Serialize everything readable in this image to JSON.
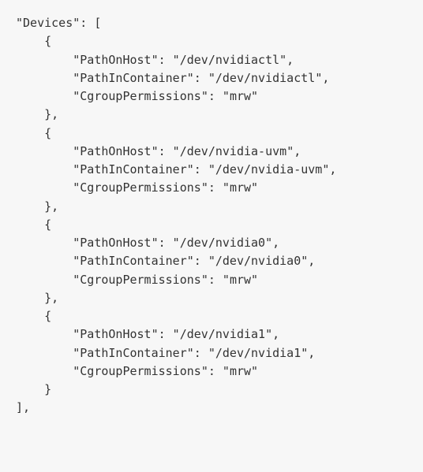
{
  "arrayKey": "Devices",
  "items": [
    {
      "PathOnHost": "/dev/nvidiactl",
      "PathInContainer": "/dev/nvidiactl",
      "CgroupPermissions": "mrw"
    },
    {
      "PathOnHost": "/dev/nvidia-uvm",
      "PathInContainer": "/dev/nvidia-uvm",
      "CgroupPermissions": "mrw"
    },
    {
      "PathOnHost": "/dev/nvidia0",
      "PathInContainer": "/dev/nvidia0",
      "CgroupPermissions": "mrw"
    },
    {
      "PathOnHost": "/dev/nvidia1",
      "PathInContainer": "/dev/nvidia1",
      "CgroupPermissions": "mrw"
    }
  ],
  "keys": {
    "pathOnHost": "PathOnHost",
    "pathInContainer": "PathInContainer",
    "cgroupPermissions": "CgroupPermissions"
  }
}
